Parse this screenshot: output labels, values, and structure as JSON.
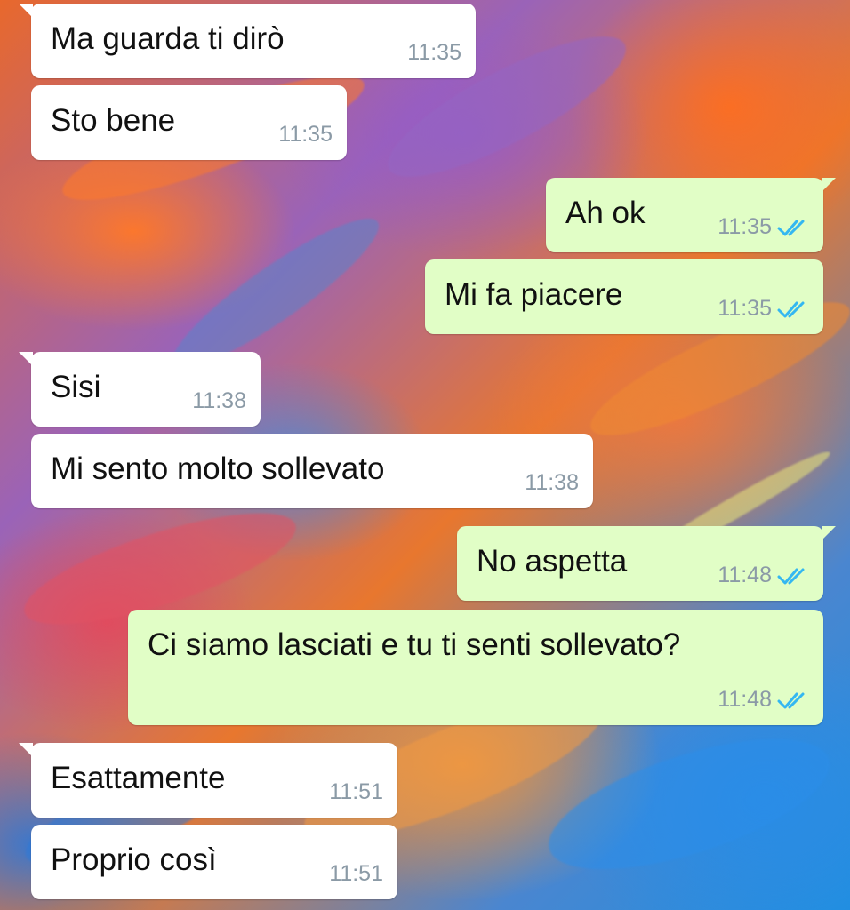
{
  "messages": [
    {
      "direction": "incoming",
      "text": "Ma guarda ti dirò",
      "time": "11:35",
      "tail": true
    },
    {
      "direction": "incoming",
      "text": "Sto bene",
      "time": "11:35",
      "tail": false
    },
    {
      "direction": "outgoing",
      "text": "Ah ok",
      "time": "11:35",
      "tail": true,
      "status": "read"
    },
    {
      "direction": "outgoing",
      "text": "Mi fa piacere",
      "time": "11:35",
      "tail": false,
      "status": "read"
    },
    {
      "direction": "incoming",
      "text": "Sisi",
      "time": "11:38",
      "tail": true
    },
    {
      "direction": "incoming",
      "text": "Mi sento molto sollevato",
      "time": "11:38",
      "tail": false
    },
    {
      "direction": "outgoing",
      "text": "No aspetta",
      "time": "11:48",
      "tail": true,
      "status": "read"
    },
    {
      "direction": "outgoing",
      "text": "Ci siamo lasciati e tu ti senti sollevato?",
      "time": "11:48",
      "tail": false,
      "status": "read"
    },
    {
      "direction": "incoming",
      "text": "Esattamente",
      "time": "11:51",
      "tail": true
    },
    {
      "direction": "incoming",
      "text": "Proprio così",
      "time": "11:51",
      "tail": false
    }
  ],
  "colors": {
    "incoming_bubble": "#ffffff",
    "outgoing_bubble": "#e1fec6",
    "timestamp": "#8b9aa6",
    "read_check": "#34b7f1"
  },
  "icons": {
    "read_status": "double-check-icon"
  }
}
